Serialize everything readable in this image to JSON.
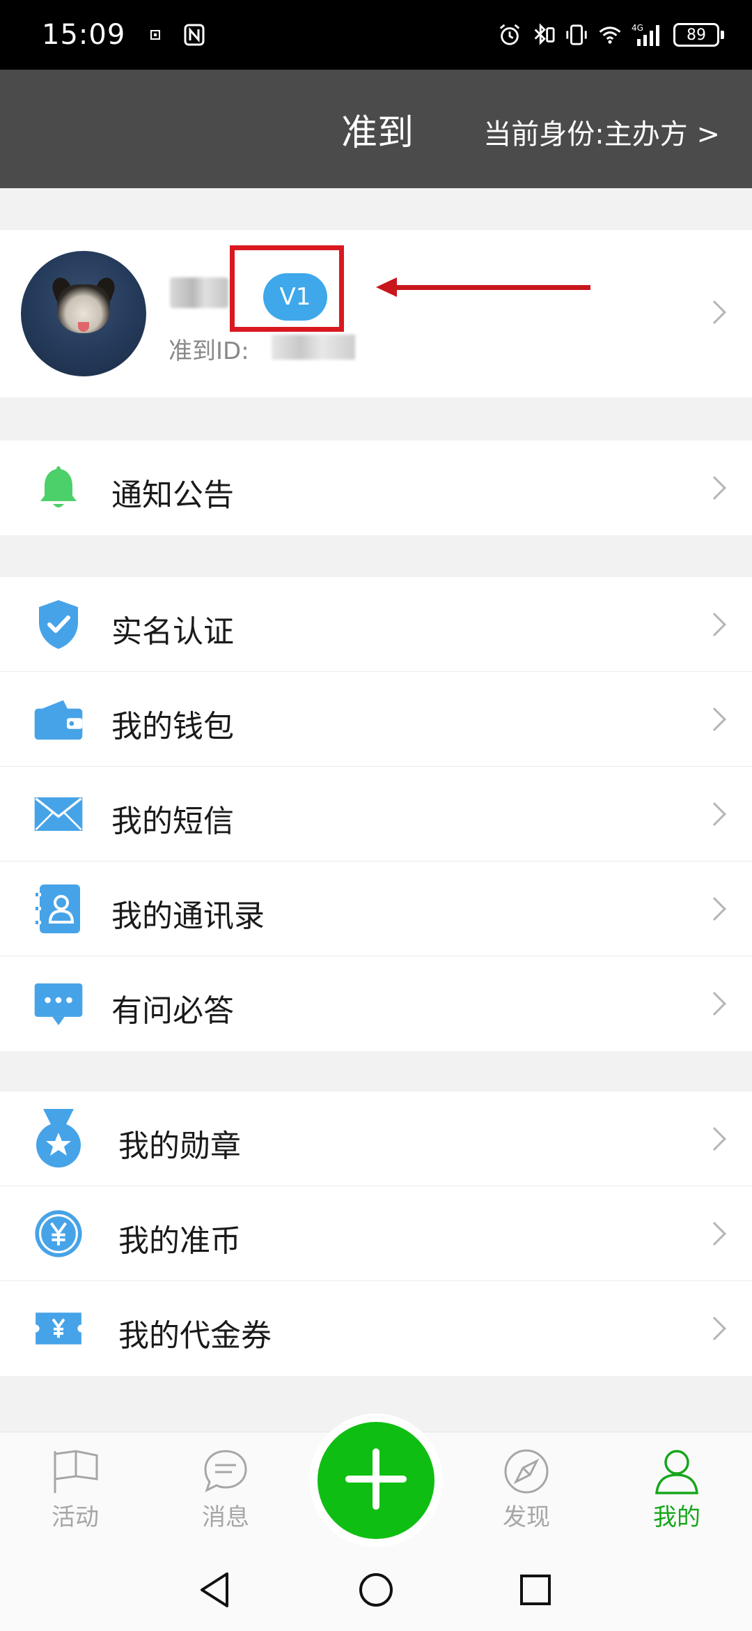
{
  "status_bar": {
    "time": "15:09",
    "battery": "89",
    "icons": [
      "notification-dot-icon",
      "nfc-icon",
      "alarm-icon",
      "bluetooth-icon",
      "vibrate-icon",
      "wifi-icon",
      "signal-4g-icon",
      "battery-icon"
    ]
  },
  "header": {
    "title": "准到",
    "identity": "当前身份:主办方 >"
  },
  "profile": {
    "badge": "V1",
    "id_label": "准到ID:"
  },
  "notice_group": {
    "items": [
      {
        "label": "通知公告",
        "icon": "bell-icon",
        "color": "#4cd06a"
      }
    ]
  },
  "account_group": {
    "items": [
      {
        "label": "实名认证",
        "icon": "shield-check-icon",
        "color": "#46a3e8"
      },
      {
        "label": "我的钱包",
        "icon": "wallet-icon",
        "color": "#46a3e8"
      },
      {
        "label": "我的短信",
        "icon": "envelope-icon",
        "color": "#46a3e8"
      },
      {
        "label": "我的通讯录",
        "icon": "contacts-book-icon",
        "color": "#46a3e8"
      },
      {
        "label": "有问必答",
        "icon": "chat-bubble-icon",
        "color": "#46a3e8"
      }
    ]
  },
  "rewards_group": {
    "items": [
      {
        "label": "我的勋章",
        "icon": "medal-icon",
        "color": "#46a3e8"
      },
      {
        "label": "我的准币",
        "icon": "yuan-coin-icon",
        "color": "#46a3e8"
      },
      {
        "label": "我的代金券",
        "icon": "voucher-ticket-icon",
        "color": "#46a3e8"
      }
    ]
  },
  "bottom_nav": {
    "items": [
      {
        "label": "活动",
        "icon": "flag-icon"
      },
      {
        "label": "消息",
        "icon": "message-icon"
      },
      {
        "label": "发现",
        "icon": "compass-icon"
      },
      {
        "label": "我的",
        "icon": "user-icon",
        "active": true
      }
    ],
    "fab_icon": "plus-icon",
    "active_color": "#16a61a",
    "fab_color": "#0fbe12"
  },
  "system_nav": {
    "icons": [
      "back-icon",
      "home-icon",
      "recents-icon"
    ]
  }
}
